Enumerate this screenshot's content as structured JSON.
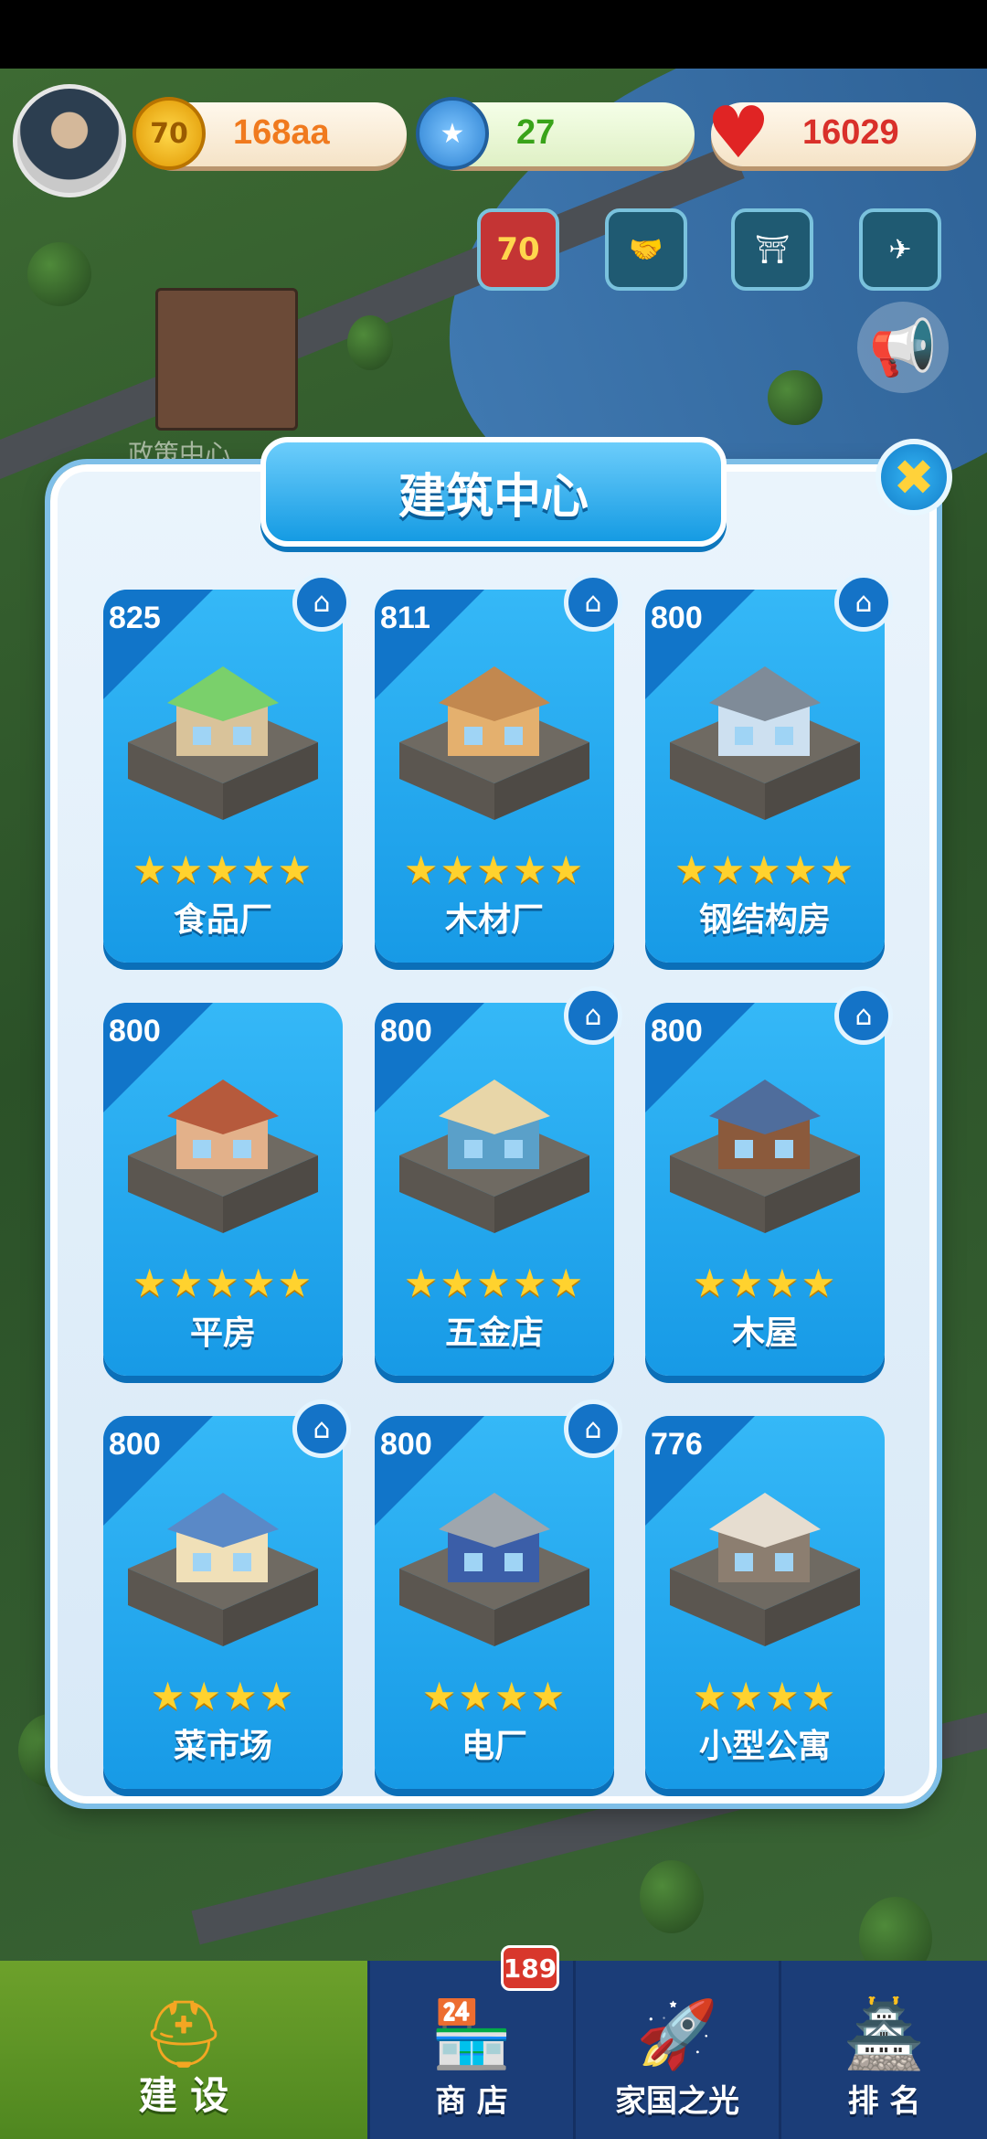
{
  "hud": {
    "coins": "168aa",
    "stars": "27",
    "hearts": "16029",
    "event_badge": "70",
    "colors": {
      "coin": "#f07a1e",
      "stars": "#39a319",
      "hearts": "#d9302a"
    }
  },
  "scene": {
    "label": "政策中心"
  },
  "modal": {
    "title": "建筑中心",
    "buildings": [
      {
        "name": "食品厂",
        "score": "825",
        "stars": 5,
        "home": true,
        "icon": "food-factory-icon"
      },
      {
        "name": "木材厂",
        "score": "811",
        "stars": 5,
        "home": true,
        "icon": "lumber-mill-icon"
      },
      {
        "name": "钢结构房",
        "score": "800",
        "stars": 5,
        "home": true,
        "icon": "steel-house-icon"
      },
      {
        "name": "平房",
        "score": "800",
        "stars": 5,
        "home": false,
        "icon": "bungalow-icon"
      },
      {
        "name": "五金店",
        "score": "800",
        "stars": 5,
        "home": true,
        "icon": "hardware-store-icon"
      },
      {
        "name": "木屋",
        "score": "800",
        "stars": 4,
        "home": true,
        "icon": "wooden-house-icon"
      },
      {
        "name": "菜市场",
        "score": "800",
        "stars": 4,
        "home": true,
        "icon": "vegetable-market-icon"
      },
      {
        "name": "电厂",
        "score": "800",
        "stars": 4,
        "home": true,
        "icon": "power-plant-icon"
      },
      {
        "name": "小型公寓",
        "score": "776",
        "stars": 4,
        "home": false,
        "icon": "small-apartment-icon"
      }
    ]
  },
  "nav": {
    "build": "建 设",
    "shop": "商 店",
    "shop_badge": "189",
    "homeland": "家国之光",
    "rank": "排 名"
  }
}
